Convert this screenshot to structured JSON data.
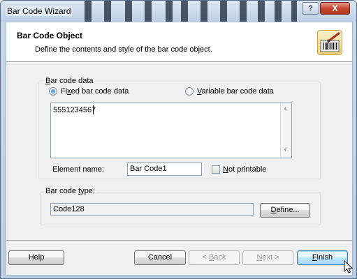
{
  "window": {
    "title": "Bar Code Wizard",
    "help_glyph": "?",
    "close_glyph": "X"
  },
  "header": {
    "title": "Bar Code Object",
    "subtitle": "Define the contents and style of the bar code object.",
    "icon": "barcode-pen-icon"
  },
  "barcode_data": {
    "group_label_accel": "B",
    "group_label_rest": "ar code data",
    "fixed_label_pre": "Fi",
    "fixed_label_accel": "x",
    "fixed_label_post": "ed bar code data",
    "fixed_checked": true,
    "variable_label_accel": "V",
    "variable_label_rest": "ariable bar code data",
    "variable_checked": false,
    "value": "5551234567"
  },
  "element": {
    "name_label": "Element name:",
    "name_value": "Bar Code1",
    "not_printable_accel": "N",
    "not_printable_rest": "ot printable",
    "not_printable_checked": false
  },
  "barcode_type": {
    "group_label_pre": "Bar code ",
    "group_label_accel": "t",
    "group_label_post": "ype:",
    "value": "Code128",
    "define_accel": "D",
    "define_rest": "efine..."
  },
  "buttons": {
    "help": "Help",
    "cancel": "Cancel",
    "back_prefix": "< ",
    "back_accel": "B",
    "back_rest": "ack",
    "next_accel": "N",
    "next_rest": "ext >",
    "finish_accel": "F",
    "finish_rest": "inish"
  }
}
